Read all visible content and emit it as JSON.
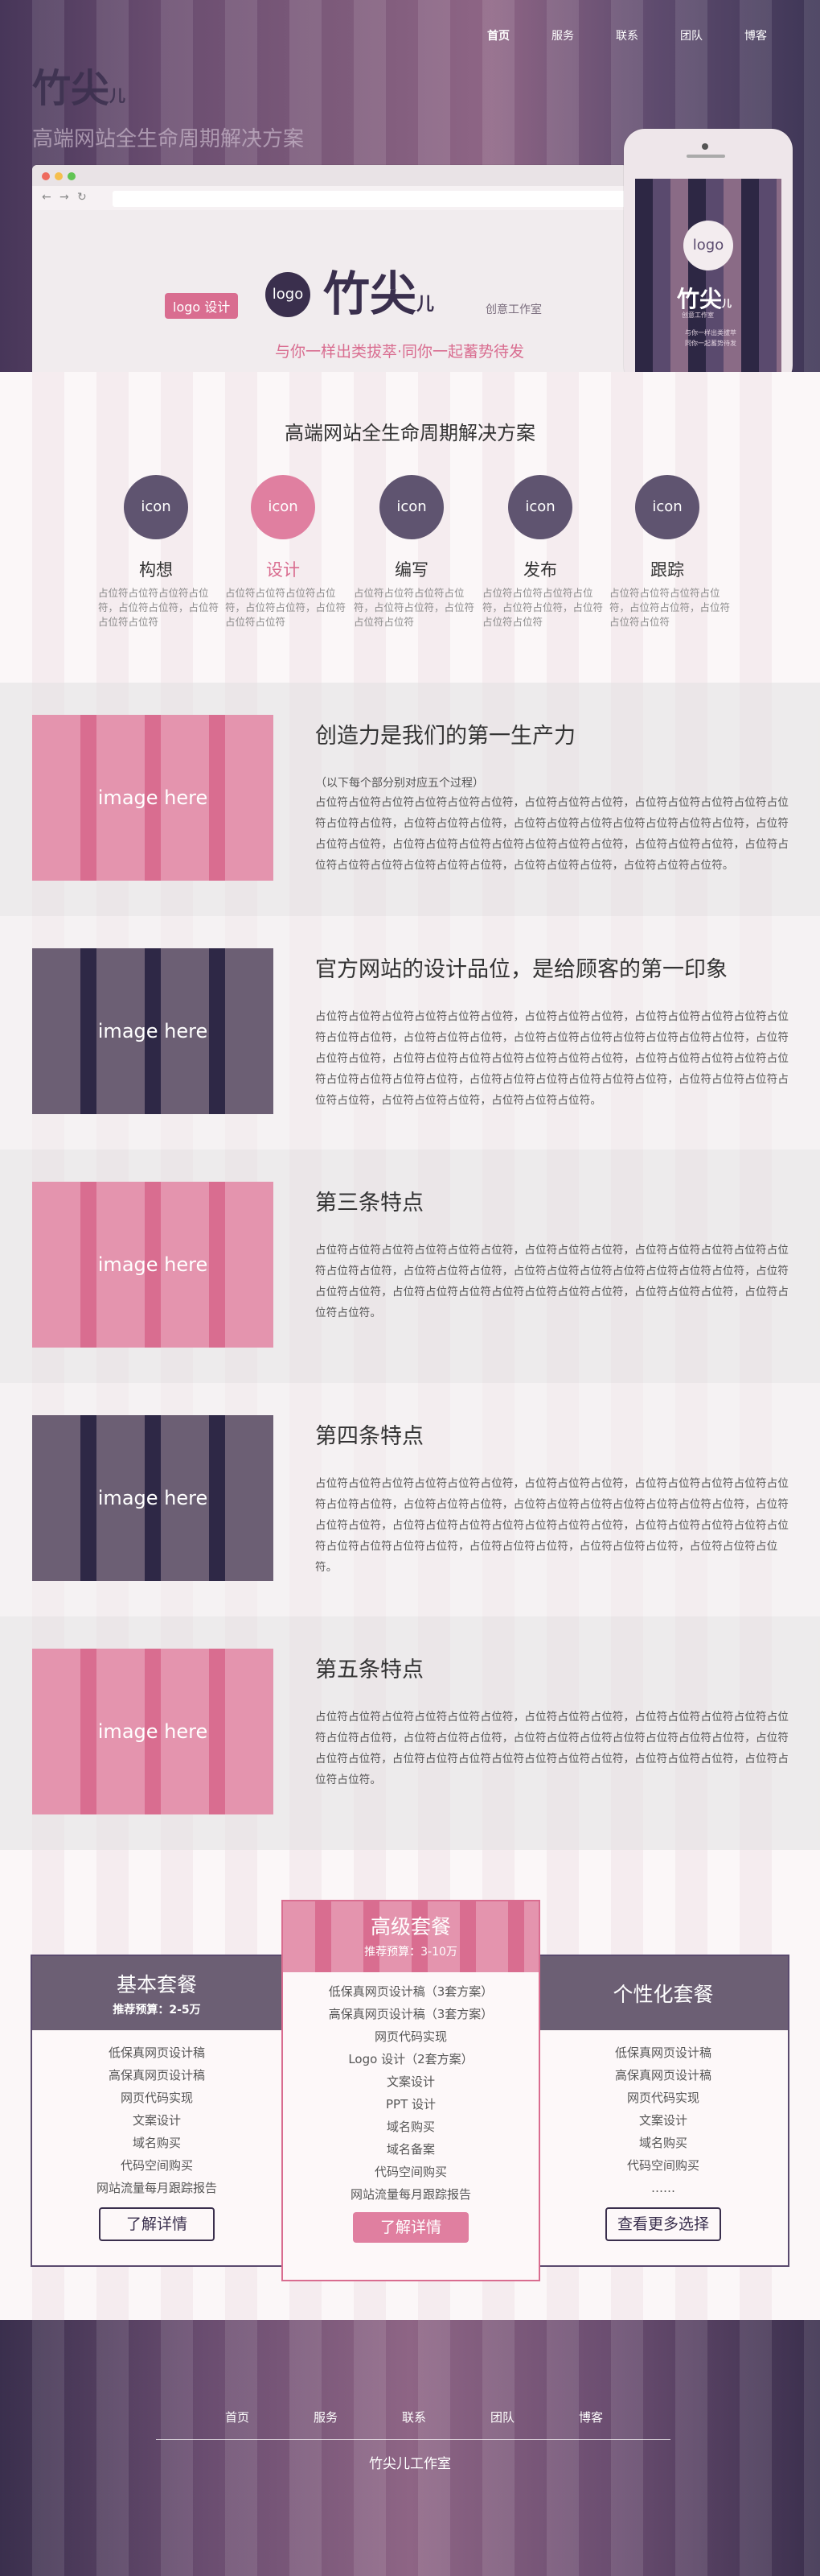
{
  "nav": {
    "items": [
      "首页",
      "服务",
      "联系",
      "团队",
      "博客"
    ]
  },
  "hero": {
    "logo_text": "竹尖",
    "logo_suffix": "儿",
    "tagline": "高端网站全生命周期解决方案",
    "badge": "logo 设计",
    "circle_logo": "logo",
    "brand_name": "竹尖",
    "brand_suffix": "儿",
    "brand_sub": "创意工作室",
    "slogan": "与你一样出类拔萃·同你一起蓄势待发",
    "phone": {
      "logo": "logo",
      "name": "竹尖",
      "suffix": "儿",
      "sub": "创意工作室",
      "line1": "与你一样出类拔萃",
      "line2": "同你一起蓄势待发"
    }
  },
  "lifecycle": {
    "title": "高端网站全生命周期解决方案",
    "features": [
      {
        "icon": "icon",
        "name": "构想",
        "desc": "占位符占位符占位符占位符，占位符占位符，占位符占位符占位符"
      },
      {
        "icon": "icon",
        "name": "设计",
        "desc": "占位符占位符占位符占位符，占位符占位符，占位符占位符占位符"
      },
      {
        "icon": "icon",
        "name": "编写",
        "desc": "占位符占位符占位符占位符，占位符占位符，占位符占位符占位符"
      },
      {
        "icon": "icon",
        "name": "发布",
        "desc": "占位符占位符占位符占位符，占位符占位符，占位符占位符占位符"
      },
      {
        "icon": "icon",
        "name": "跟踪",
        "desc": "占位符占位符占位符占位符，占位符占位符，占位符占位符占位符"
      }
    ]
  },
  "sections": [
    {
      "image": "image here",
      "title": "创造力是我们的第一生产力",
      "note": "（以下每个部分别对应五个过程）",
      "body": "占位符占位符占位符占位符占位符占位符，占位符占位符占位符，占位符占位符占位符占位符占位符占位符占位符，占位符占位符占位符，占位符占位符占位符占位符占位符占位符占位符，占位符占位符占位符，占位符占位符占位符占位符占位符占位符占位符，占位符占位符占位符，占位符占位符占位符占位符占位符占位符占位符，占位符占位符占位符，占位符占位符占位符。"
    },
    {
      "image": "image here",
      "title": "官方网站的设计品位，是给顾客的第一印象",
      "note": "",
      "body": "占位符占位符占位符占位符占位符占位符，占位符占位符占位符，占位符占位符占位符占位符占位符占位符占位符，占位符占位符占位符，占位符占位符占位符占位符占位符占位符占位符，占位符占位符占位符，占位符占位符占位符占位符占位符占位符占位符，占位符占位符占位符占位符占位符占位符占位符占位符占位符，占位符占位符占位符占位符占位符占位符，占位符占位符占位符占位符占位符，占位符占位符占位符，占位符占位符占位符。"
    },
    {
      "image": "image here",
      "title": "第三条特点",
      "note": "",
      "body": "占位符占位符占位符占位符占位符占位符，占位符占位符占位符，占位符占位符占位符占位符占位符占位符占位符，占位符占位符占位符，占位符占位符占位符占位符占位符占位符占位符，占位符占位符占位符，占位符占位符占位符占位符占位符占位符占位符，占位符占位符占位符，占位符占位符占位符。"
    },
    {
      "image": "image here",
      "title": "第四条特点",
      "note": "",
      "body": "占位符占位符占位符占位符占位符占位符，占位符占位符占位符，占位符占位符占位符占位符占位符占位符占位符，占位符占位符占位符，占位符占位符占位符占位符占位符占位符占位符，占位符占位符占位符，占位符占位符占位符占位符占位符占位符占位符，占位符占位符占位符占位符占位符占位符占位符占位符占位符，占位符占位符占位符，占位符占位符占位符，占位符占位符占位符。"
    },
    {
      "image": "image here",
      "title": "第五条特点",
      "note": "",
      "body": "占位符占位符占位符占位符占位符占位符，占位符占位符占位符，占位符占位符占位符占位符占位符占位符占位符，占位符占位符占位符，占位符占位符占位符占位符占位符占位符占位符，占位符占位符占位符，占位符占位符占位符占位符占位符占位符占位符，占位符占位符占位符，占位符占位符占位符。"
    }
  ],
  "plans": {
    "basic": {
      "title": "基本套餐",
      "price": "推荐预算：2-5万",
      "items": [
        "低保真网页设计稿",
        "高保真网页设计稿",
        "网页代码实现",
        "文案设计",
        "域名购买",
        "代码空间购买",
        "网站流量每月跟踪报告"
      ],
      "button": "了解详情"
    },
    "premium": {
      "title": "高级套餐",
      "price": "推荐预算：3-10万",
      "items": [
        "低保真网页设计稿（3套方案）",
        "高保真网页设计稿（3套方案）",
        "网页代码实现",
        "Logo 设计（2套方案）",
        "文案设计",
        "PPT 设计",
        "域名购买",
        "域名备案",
        "代码空间购买",
        "网站流量每月跟踪报告"
      ],
      "button": "了解详情"
    },
    "custom": {
      "title": "个性化套餐",
      "items": [
        "低保真网页设计稿",
        "高保真网页设计稿",
        "网页代码实现",
        "文案设计",
        "域名购买",
        "代码空间购买",
        "……"
      ],
      "button": "查看更多选择"
    }
  },
  "footer": {
    "nav": [
      "首页",
      "服务",
      "联系",
      "团队",
      "博客"
    ],
    "copyright": "竹尖儿工作室"
  },
  "colors": {
    "pink": "#d96d90",
    "dark": "#3a2f4d",
    "purple": "#5a4a6e"
  }
}
